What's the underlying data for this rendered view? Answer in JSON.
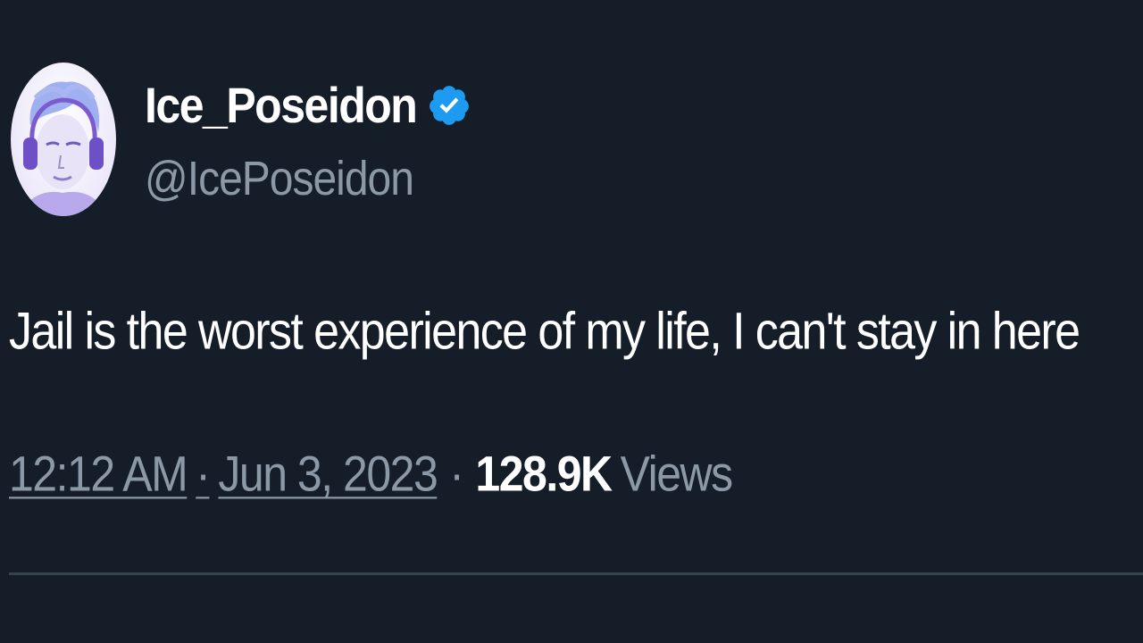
{
  "author": {
    "display_name": "Ice_Poseidon",
    "handle": "@IcePoseidon",
    "verified": true,
    "avatar_icon": "user-avatar",
    "verified_icon": "verified-badge-icon",
    "verified_color": "#1d9bf0"
  },
  "tweet": {
    "text": "Jail is the worst experience of my life, I can't stay in here",
    "time": "12:12 AM",
    "date": "Jun 3, 2023",
    "separator": "·",
    "views_count": "128.9K",
    "views_label": "Views"
  },
  "theme": {
    "background": "#151d28",
    "text_primary": "#ffffff",
    "text_secondary": "#8b98a5"
  }
}
